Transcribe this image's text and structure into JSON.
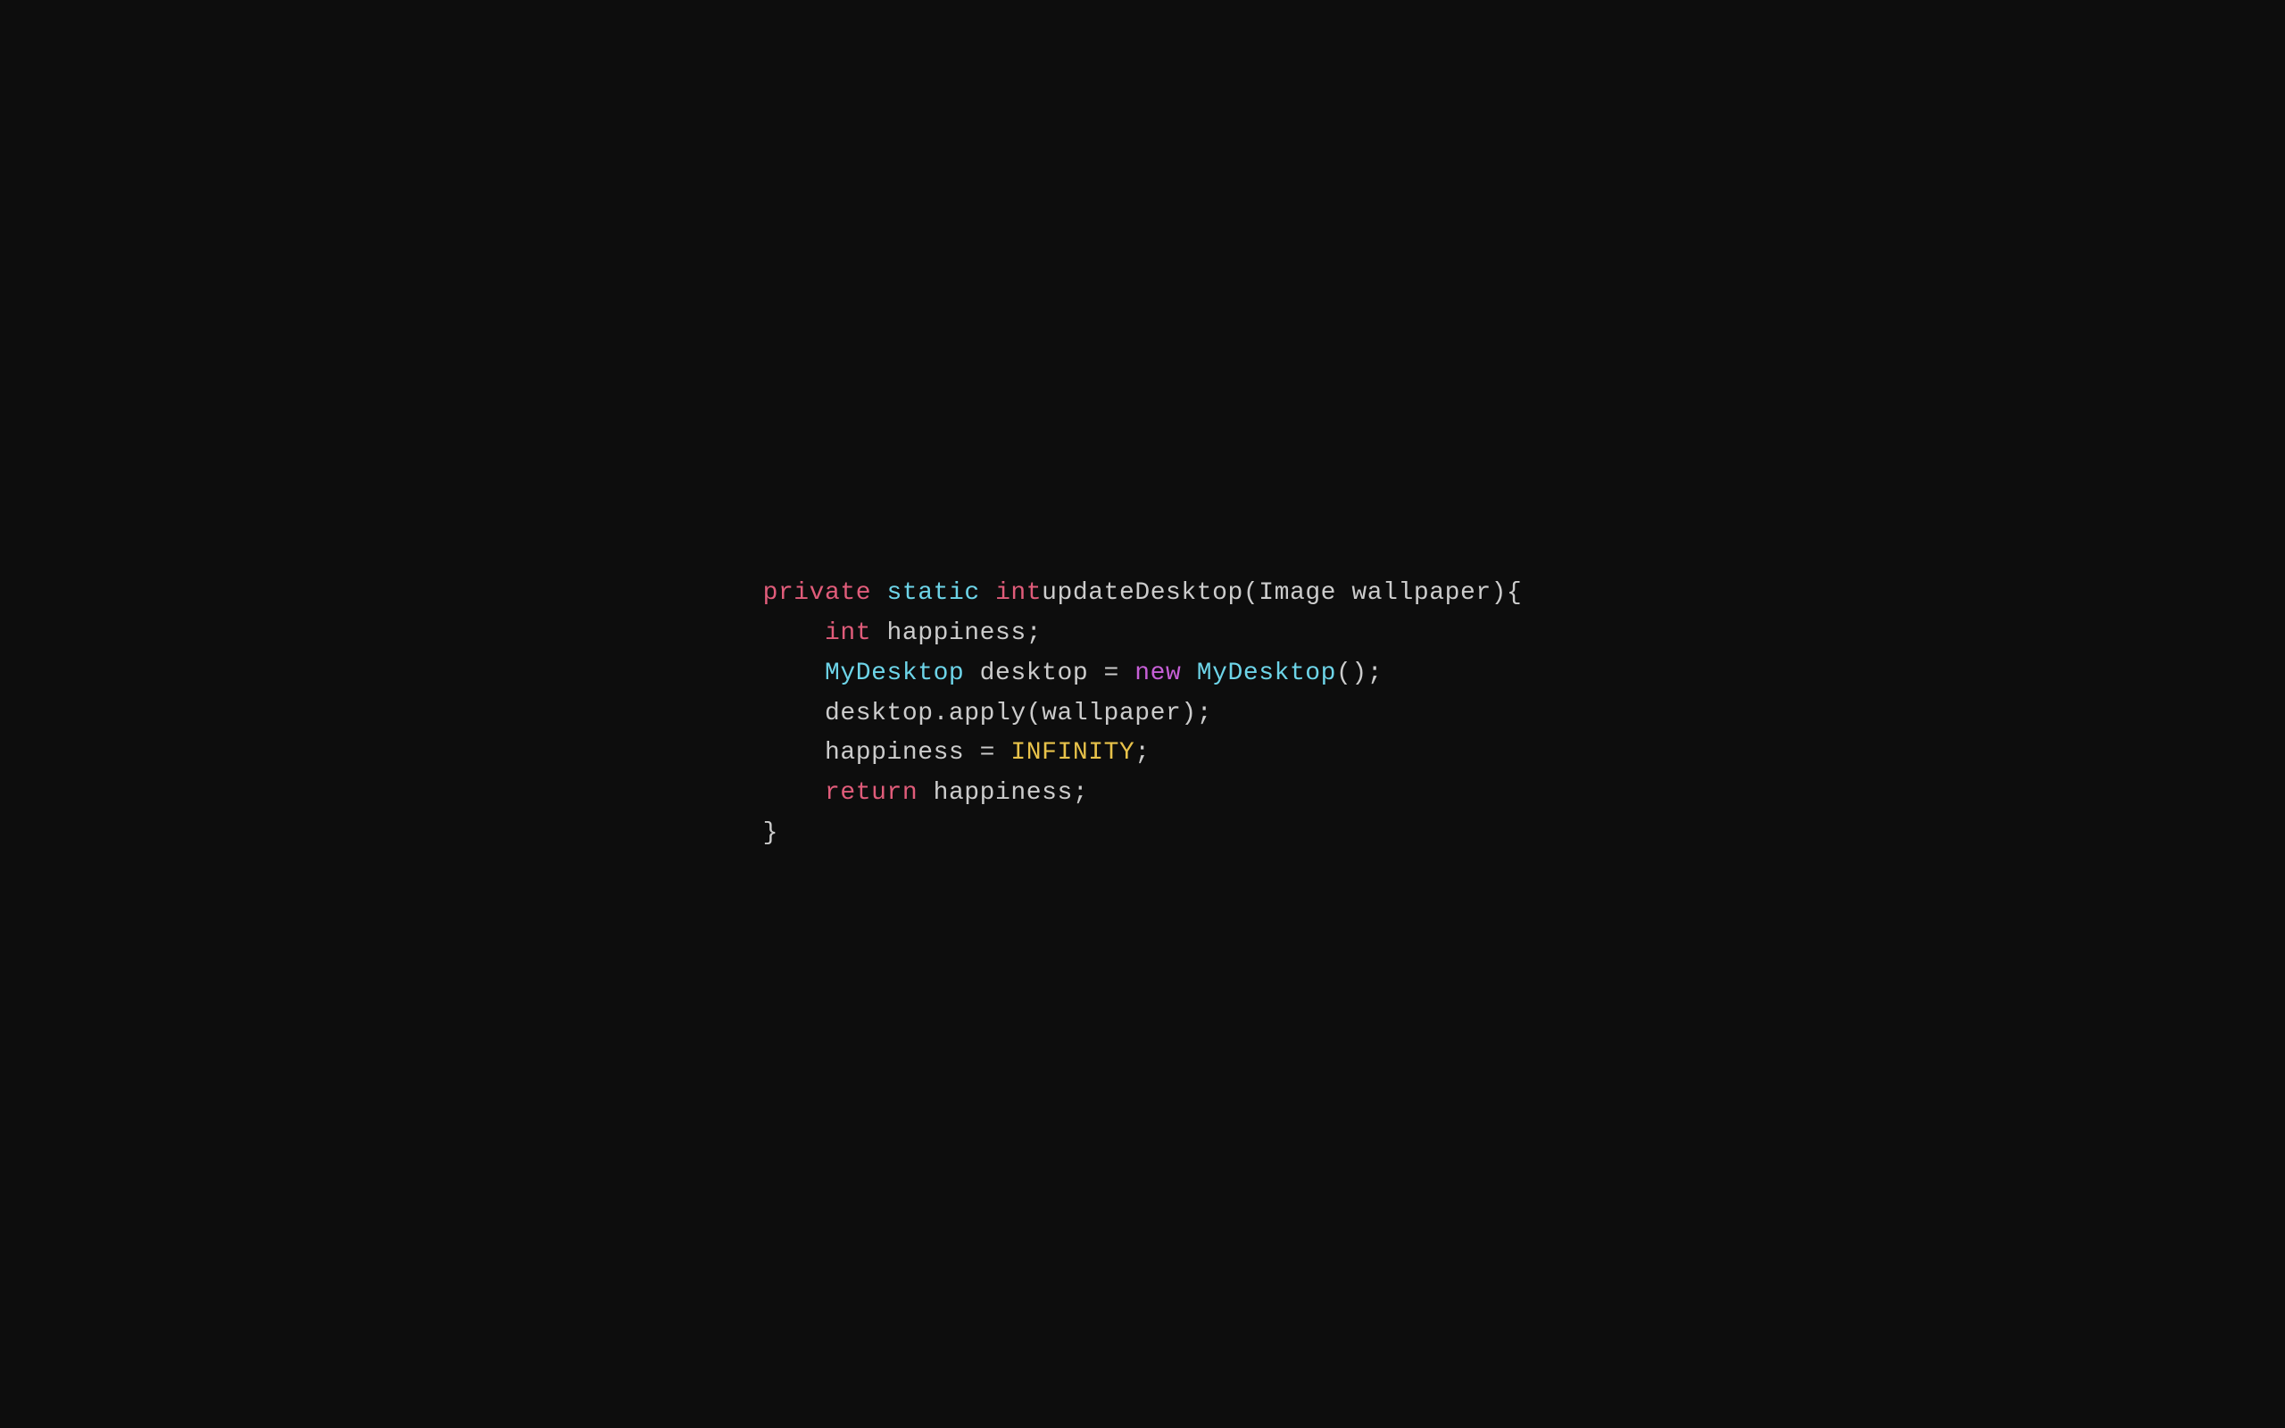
{
  "code": {
    "line1": {
      "private": "private",
      "space1": " ",
      "static": "static",
      "space2": " ",
      "int": "int",
      "space3": " ",
      "rest": "updateDesktop(Image wallpaper){"
    },
    "line2": {
      "indent": "    ",
      "int": "int",
      "rest": " happiness;"
    },
    "line3": {
      "indent": "    ",
      "mydesktop": "MyDesktop",
      "rest1": " desktop = ",
      "new": "new",
      "rest2": " ",
      "mydesktop2": "MyDesktop",
      "rest3": "();"
    },
    "line4": {
      "indent": "    ",
      "rest": "desktop.apply(wallpaper);"
    },
    "line5": {
      "indent": "    ",
      "rest1": "happiness = ",
      "infinity": "INFINITY",
      "rest2": ";"
    },
    "line6": {
      "indent": "    ",
      "return": "return",
      "rest": " happiness;"
    },
    "line7": {
      "rest": "}"
    }
  }
}
